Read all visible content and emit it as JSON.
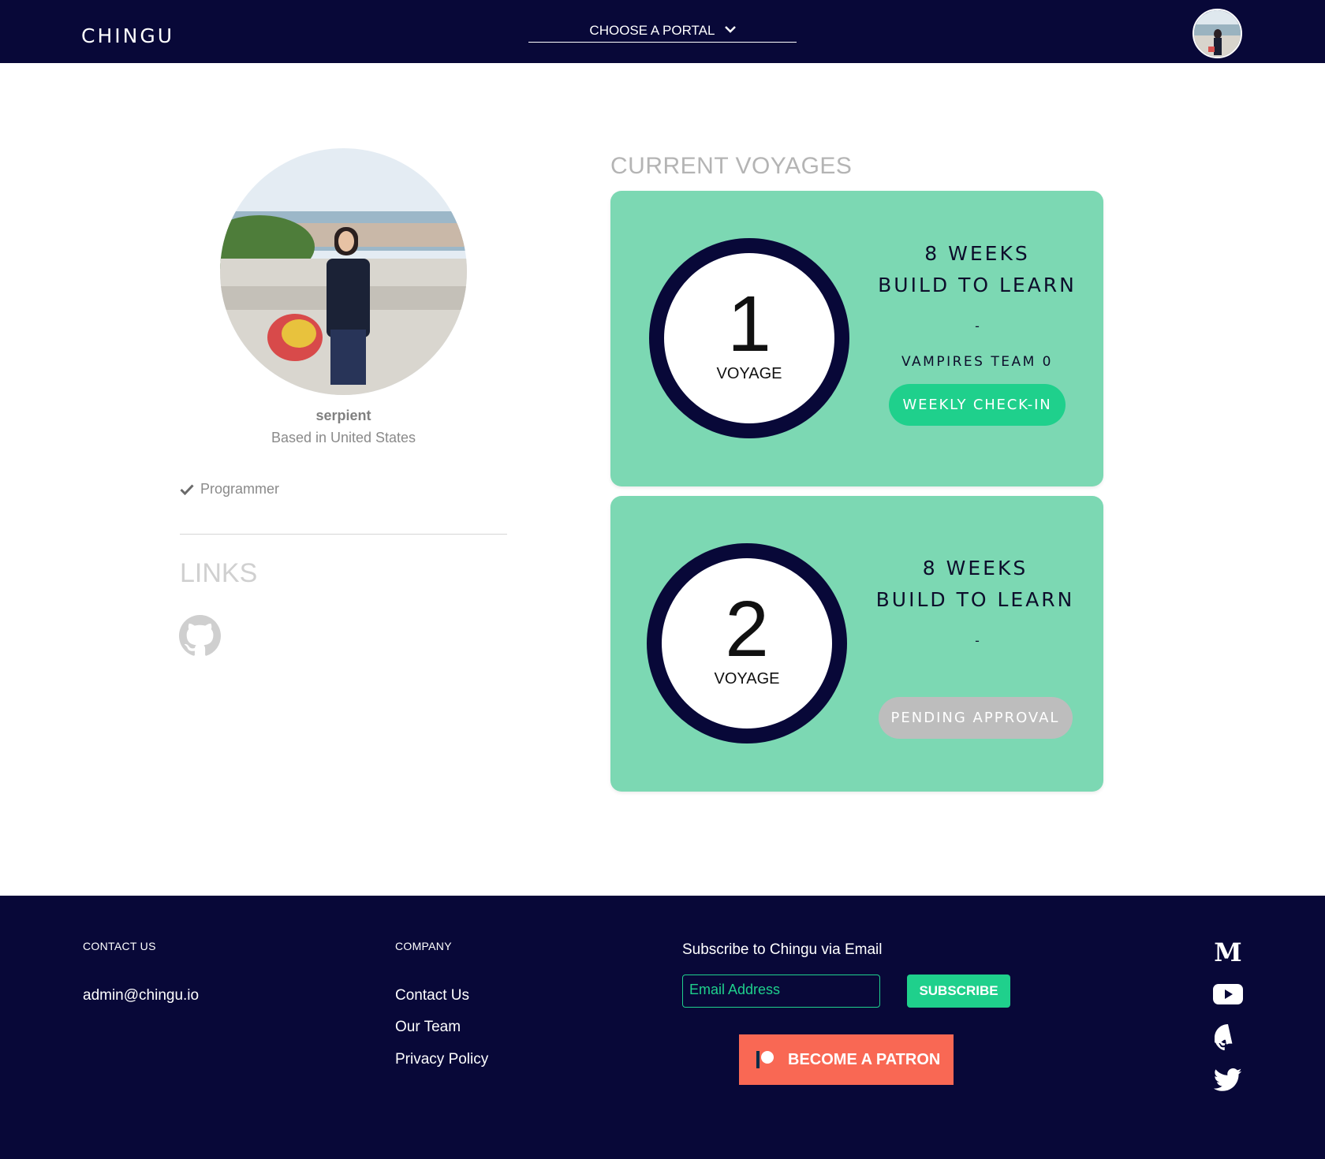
{
  "header": {
    "brand": "CHINGU",
    "portal_label": "CHOOSE A PORTAL"
  },
  "profile": {
    "username": "serpient",
    "location": "Based in United States",
    "skills": [
      "Programmer"
    ],
    "links_title": "LINKS"
  },
  "voyages": {
    "title": "CURRENT VOYAGES",
    "cards": [
      {
        "number": "1",
        "label": "VOYAGE",
        "duration": "8 WEEKS",
        "program": "BUILD TO LEARN",
        "dash": "-",
        "team": "VAMPIRES TEAM 0",
        "action": "WEEKLY CHECK-IN"
      },
      {
        "number": "2",
        "label": "VOYAGE",
        "duration": "8 WEEKS",
        "program": "BUILD TO LEARN",
        "dash": "-",
        "action": "PENDING APPROVAL"
      }
    ]
  },
  "footer": {
    "contact_heading": "CONTACT US",
    "email": "admin@chingu.io",
    "company_heading": "COMPANY",
    "company_links": [
      "Contact Us",
      "Our Team",
      "Privacy Policy"
    ],
    "subscribe_heading": "Subscribe to Chingu via Email",
    "email_placeholder": "Email Address",
    "subscribe_button": "SUBSCRIBE",
    "patron_button": "BECOME A PATRON",
    "social_icons": [
      "medium-icon",
      "youtube-icon",
      "github-icon",
      "twitter-icon"
    ]
  },
  "colors": {
    "navy": "#080838",
    "card_green": "#7cd8b3",
    "accent_green": "#1fd08c",
    "pending_gray": "#bdbdbd",
    "patron_coral": "#f96854"
  }
}
